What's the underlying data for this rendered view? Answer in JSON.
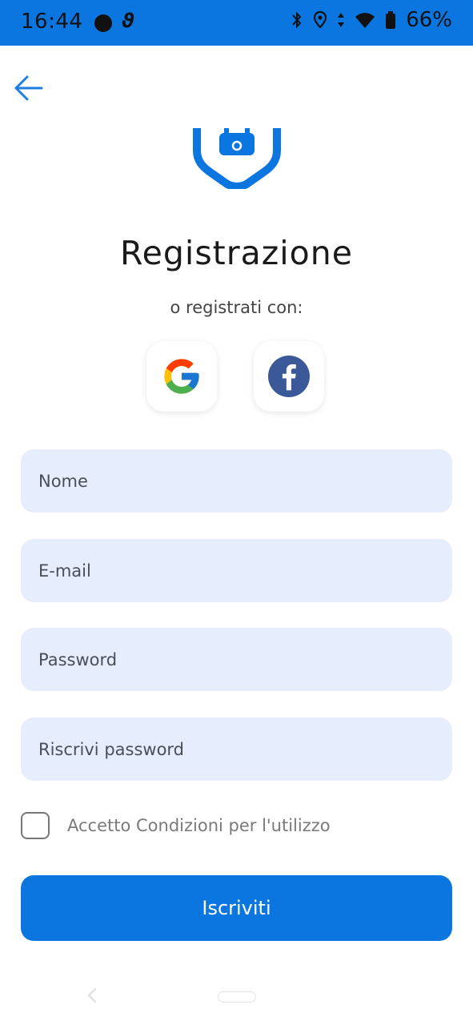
{
  "status_bar": {
    "time": "16:44",
    "battery_percent": "66%",
    "icons": [
      "notification-dot-icon",
      "app-notification-icon",
      "bluetooth-icon",
      "location-icon",
      "data-arrows-icon",
      "wifi-icon",
      "battery-icon"
    ],
    "background_color": "#0b76e0"
  },
  "header": {
    "back_icon": "arrow-left-icon"
  },
  "logo": {
    "icon": "shield-logo-icon",
    "color": "#0b76e0"
  },
  "title": "Registrazione",
  "subtitle": "o registrati con:",
  "social": [
    {
      "name": "Google",
      "icon": "google-icon"
    },
    {
      "name": "Facebook",
      "icon": "facebook-icon"
    }
  ],
  "form": {
    "name_placeholder": "Nome",
    "email_placeholder": "E-mail",
    "password_placeholder": "Password",
    "repeat_password_placeholder": "Riscrivi password",
    "terms_label": "Accetto Condizioni per l'utilizzo",
    "terms_checked": false,
    "submit_label": "Iscriviti"
  },
  "colors": {
    "primary": "#0b76e0",
    "field_background": "#e6eefe"
  }
}
